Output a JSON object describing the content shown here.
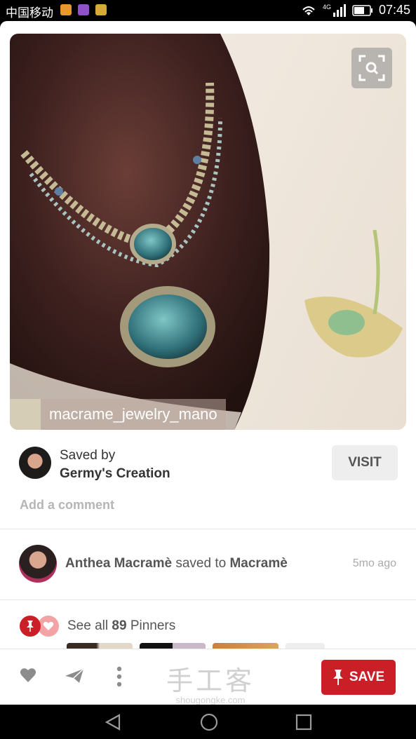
{
  "status_bar": {
    "carrier": "中国移动",
    "network": "4G",
    "time": "07:45",
    "app_icons": [
      "orange-app-icon",
      "purple-app-icon",
      "yellow-app-icon"
    ]
  },
  "pin": {
    "source_label": "macrame_jewelry_mano",
    "lens_icon": "visual-search-icon"
  },
  "saved_by": {
    "prefix": "Saved by",
    "name": "Germy's Creation",
    "visit_label": "VISIT"
  },
  "comment_placeholder": "Add a comment",
  "activity": {
    "user": "Anthea Macramè",
    "verb": "saved to",
    "board": "Macramè",
    "time": "5mo ago"
  },
  "pinners": {
    "prefix": "See all",
    "count": "89",
    "suffix": "Pinners"
  },
  "bottom_bar": {
    "save_label": "SAVE"
  },
  "watermark": {
    "main": "手工客",
    "sub": "shougongke.com"
  },
  "colors": {
    "accent": "#cb1f27",
    "text": "#333333",
    "muted": "#b5b5b5"
  }
}
